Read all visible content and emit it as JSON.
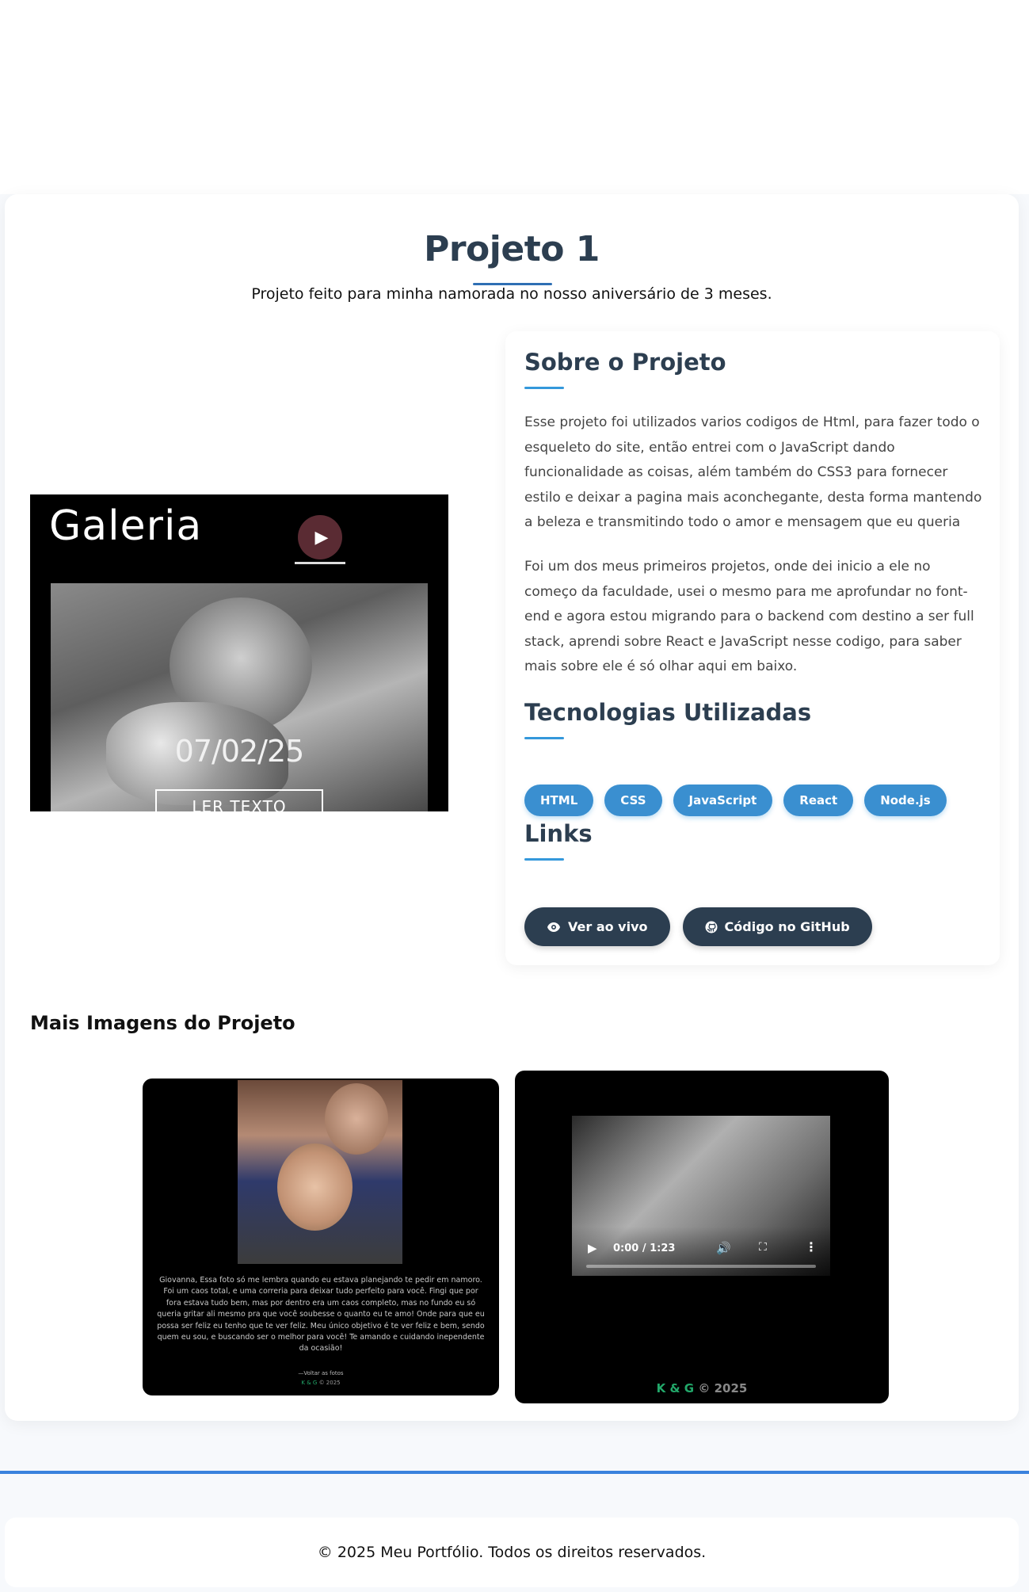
{
  "project": {
    "title": "Projeto 1",
    "subtitle": "Projeto feito para minha namorada no nosso aniversário de 3 meses."
  },
  "preview": {
    "gallery_word": "Galeria",
    "date": "07/02/25",
    "button": "LER TEXTO"
  },
  "about": {
    "heading": "Sobre o Projeto",
    "paragraph1": "Esse projeto foi utilizados varios codigos de Html, para fazer todo o esqueleto do site, então entrei com o JavaScript dando funcionalidade as coisas, além também do CSS3 para fornecer estilo e deixar a pagina mais aconchegante, desta forma mantendo a beleza e transmitindo todo o amor e mensagem que eu queria",
    "paragraph2": "Foi um dos meus primeiros projetos, onde dei inicio a ele no começo da faculdade, usei o mesmo para me aprofundar no font-end e agora estou migrando para o backend com destino a ser full stack, aprendi sobre React e JavaScript nesse codigo, para saber mais sobre ele é só olhar aqui em baixo."
  },
  "tech": {
    "heading": "Tecnologias Utilizadas",
    "tags": [
      "HTML",
      "CSS",
      "JavaScript",
      "React",
      "Node.js"
    ]
  },
  "links": {
    "heading": "Links",
    "live": "Ver ao vivo",
    "github": "Código no GitHub"
  },
  "more_images": {
    "heading": "Mais Imagens do Projeto",
    "letter_text": "Giovanna, Essa foto só me lembra quando eu estava planejando te pedir em namoro. Foi um caos total, e uma correria para deixar tudo perfeito para você. Fingi que por fora estava tudo bem, mas por dentro era um caos completo, mas no fundo eu só queria gritar ali mesmo pra que você soubesse o quanto eu te amo! Onde para que eu possa ser feliz eu tenho que te ver feliz. Meu único objetivo é te ver feliz e bem, sendo quem eu sou, e buscando ser o melhor para você! Te amando e cuidando inependente da ocasião!",
    "letter_sign": "—Voltar as fotos",
    "letter_brand": "K & G",
    "letter_year": "© 2025",
    "video_time": "0:00 / 1:23",
    "video_brand": "K & G",
    "video_year": "© 2025"
  },
  "footer": {
    "text": "© 2025 Meu Portfólio. Todos os direitos reservados."
  },
  "colors": {
    "primary": "#2c3e50",
    "accent": "#3498db",
    "brand_green": "#22a86a"
  }
}
